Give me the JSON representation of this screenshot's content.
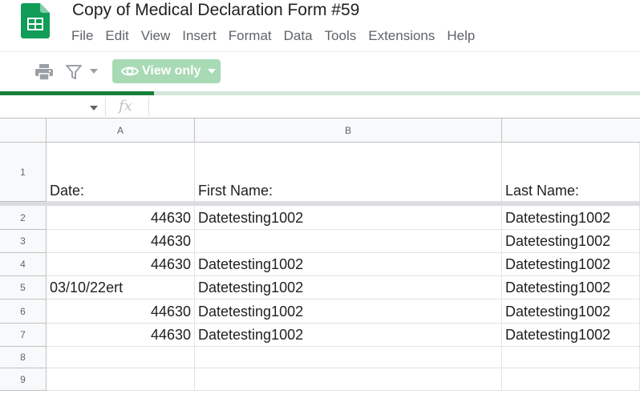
{
  "app": {
    "title": "Copy of Medical Declaration Form #59",
    "logo_icon": "google-sheets-logo",
    "brand_color": "#0f9d58"
  },
  "menu": [
    "File",
    "Edit",
    "View",
    "Insert",
    "Format",
    "Data",
    "Tools",
    "Extensions",
    "Help"
  ],
  "toolbar": {
    "print_icon": "print-icon",
    "filter_icon": "filter-icon",
    "view_only_label": "View only",
    "view_only_color": "#a8dab5"
  },
  "loading": {
    "progress": 0.24,
    "color": "#188038"
  },
  "formula_bar": {
    "fx_label": "fx",
    "value": ""
  },
  "sheet": {
    "columns": [
      "A",
      "B",
      ""
    ],
    "rows": [
      {
        "num": "1",
        "cells": [
          "Date:",
          "First Name:",
          "Last Name:"
        ]
      },
      {
        "num": "2",
        "cells": [
          "44630",
          "Datetesting1002",
          "Datetesting1002"
        ]
      },
      {
        "num": "3",
        "cells": [
          "44630",
          "",
          "Datetesting1002"
        ]
      },
      {
        "num": "4",
        "cells": [
          "44630",
          "Datetesting1002",
          "Datetesting1002"
        ]
      },
      {
        "num": "5",
        "cells": [
          "03/10/22ert",
          "Datetesting1002",
          "Datetesting1002"
        ]
      },
      {
        "num": "6",
        "cells": [
          "44630",
          "Datetesting1002",
          "Datetesting1002"
        ]
      },
      {
        "num": "7",
        "cells": [
          "44630",
          "Datetesting1002",
          "Datetesting1002"
        ]
      },
      {
        "num": "8",
        "cells": [
          "",
          "",
          ""
        ]
      },
      {
        "num": "9",
        "cells": [
          "",
          "",
          ""
        ]
      }
    ]
  }
}
